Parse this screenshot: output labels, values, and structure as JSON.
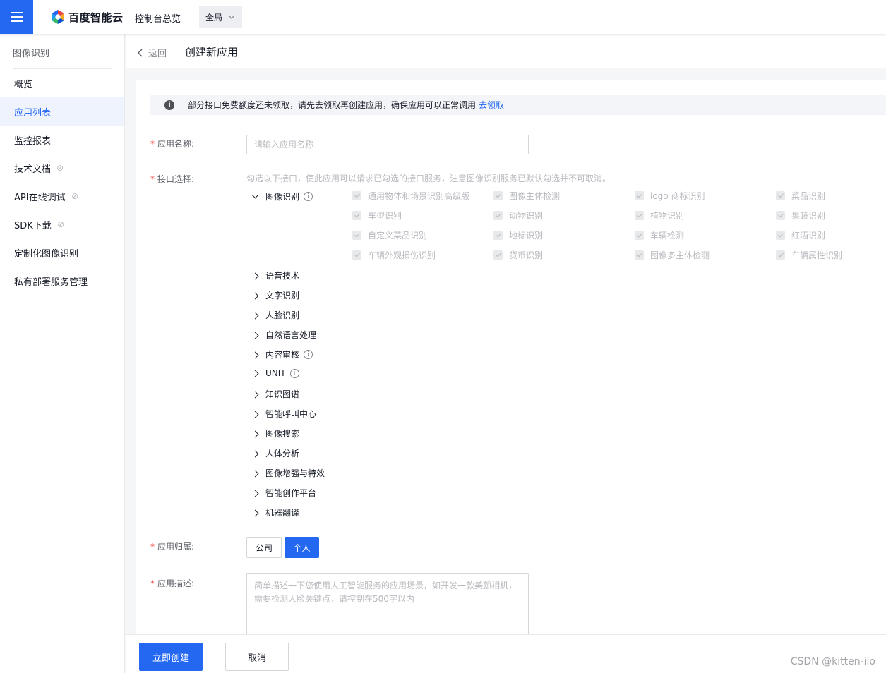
{
  "topbar": {
    "brand": "百度智能云",
    "console_link": "控制台总览",
    "region": "全局",
    "icons": {
      "menu": "hamburger-menu-icon",
      "logo": "hexagon-logo-icon",
      "region_arrow": "chevron-down-icon"
    }
  },
  "sidebar": {
    "title": "图像识别",
    "items": [
      {
        "label": "概览"
      },
      {
        "label": "应用列表"
      },
      {
        "label": "监控报表"
      },
      {
        "label": "技术文档"
      },
      {
        "label": "API在线调试"
      },
      {
        "label": "SDK下载"
      },
      {
        "label": "定制化图像识别"
      },
      {
        "label": "私有部署服务管理"
      }
    ]
  },
  "header": {
    "back_label": "返回",
    "title": "创建新应用"
  },
  "notice": {
    "text": "部分接口免费额度还未领取，请先去领取再创建应用，确保应用可以正常调用",
    "link": "去领取"
  },
  "form": {
    "name_label": "应用名称:",
    "name_placeholder": "请输入应用名称",
    "api_label": "接口选择:",
    "api_hint": "勾选以下接口，使此应用可以请求已勾选的接口服务，注意图像识别服务已默认勾选并不可取消。",
    "expanded_group": "图像识别",
    "checkboxes": [
      "通用物体和场景识别高级版",
      "图像主体检测",
      "logo 商标识别",
      "菜品识别",
      "车型识别",
      "动物识别",
      "植物识别",
      "果蔬识别",
      "自定义菜品识别",
      "地标识别",
      "车辆检测",
      "红酒识别",
      "车辆外观损伤识别",
      "货币识别",
      "图像多主体检测",
      "车辆属性识别"
    ],
    "groups": [
      "语音技术",
      "文字识别",
      "人脸识别",
      "自然语言处理",
      "内容审核",
      "UNIT",
      "知识图谱",
      "智能呼叫中心",
      "图像搜索",
      "人体分析",
      "图像增强与特效",
      "智能创作平台",
      "机器翻译"
    ],
    "belong_label": "应用归属:",
    "belong_options": [
      "公司",
      "个人"
    ],
    "belong_selected": "个人",
    "desc_label": "应用描述:",
    "desc_placeholder": "简单描述一下您使用人工智能服务的应用场景，如开发一款美颜相机，需要检测人脸关键点，请控制在500字以内"
  },
  "footer": {
    "create_button": "立即创建",
    "cancel_button": "取消",
    "watermark": "CSDN @kitten-iio"
  },
  "colors": {
    "primary": "#2468f2",
    "required": "#f33e3e",
    "muted": "#b8babf"
  }
}
